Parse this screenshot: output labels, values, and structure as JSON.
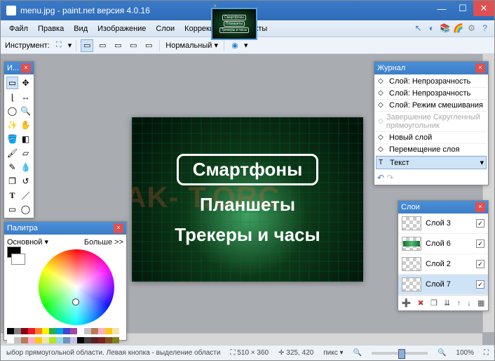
{
  "titlebar": {
    "title": "menu.jpg - paint.net версия 4.0.16"
  },
  "menubar": {
    "items": [
      "Файл",
      "Правка",
      "Вид",
      "Изображение",
      "Слои",
      "Коррекция",
      "Эффекты"
    ]
  },
  "toolbar": {
    "label": "Инструмент:",
    "blend_label": "Нормальный",
    "blend_arrow": "▾"
  },
  "thumb": {
    "l1": "Смартфоны",
    "l2": "Планшеты",
    "l3": "Трекеры и часы"
  },
  "canvas": {
    "line1": "Смартфоны",
    "line2": "Планшеты",
    "line3": "Трекеры и часы",
    "watermark": "AK-     T.ORC"
  },
  "toolbox": {
    "title": "И..."
  },
  "palette": {
    "title": "Палитра",
    "fg_label": "Основной",
    "more": "Больше >>",
    "colors_row1": [
      "#000",
      "#7f7f7f",
      "#880016",
      "#ed1c24",
      "#ff7f27",
      "#fff200",
      "#22b14c",
      "#00a2e8",
      "#3f48cc",
      "#a349a4",
      "#fff",
      "#c3c3c3",
      "#b97a57",
      "#ffaec9",
      "#ffc90e",
      "#efe4b0"
    ],
    "colors_row2": [
      "#fff",
      "#c3c3c3",
      "#b97a57",
      "#ffaec9",
      "#ffc90e",
      "#efe4b0",
      "#b5e61d",
      "#99d9ea",
      "#7092be",
      "#c8bfe7",
      "#000",
      "#404040",
      "#602020",
      "#802020",
      "#805020",
      "#808020"
    ]
  },
  "history": {
    "title": "Журнал",
    "items": [
      {
        "label": "Слой: Непрозрачность",
        "dim": false
      },
      {
        "label": "Слой: Непрозрачность",
        "dim": false
      },
      {
        "label": "Слой: Режим смешивания",
        "dim": false
      },
      {
        "label": "Завершение Скругленный прямоугольник",
        "dim": true
      },
      {
        "label": "Новый слой",
        "dim": false
      },
      {
        "label": "Перемещение слоя",
        "dim": false
      },
      {
        "label": "Текст",
        "dim": false,
        "sel": true
      }
    ]
  },
  "layers": {
    "title": "Слои",
    "items": [
      {
        "name": "Слой 3",
        "checked": true,
        "green": false
      },
      {
        "name": "Слой 6",
        "checked": true,
        "green": true
      },
      {
        "name": "Слой 2",
        "checked": true,
        "green": false
      },
      {
        "name": "Слой 7",
        "checked": true,
        "green": false,
        "sel": true
      }
    ]
  },
  "statusbar": {
    "hint": "ыбор прямоугольной области. Левая кнопка - выделение области. Квадрат - удерживайте нажатой клавишу Shift.",
    "dims": "510 × 360",
    "cursor": "325, 420",
    "unit": "пикс",
    "zoom": "100%"
  }
}
